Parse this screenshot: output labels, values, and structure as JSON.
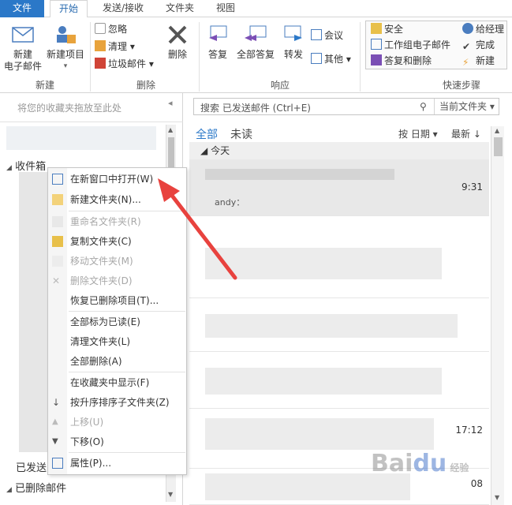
{
  "tabs": [
    "文件",
    "开始",
    "发送/接收",
    "文件夹",
    "视图"
  ],
  "ribbon": {
    "new_group": {
      "label": "新建",
      "new_mail": "新建\n电子邮件",
      "new_items": "新建项目"
    },
    "delete_group": {
      "label": "删除",
      "ignore": "忽略",
      "clean": "清理",
      "junk": "垃圾邮件",
      "delete": "删除"
    },
    "respond_group": {
      "label": "响应",
      "reply": "答复",
      "reply_all": "全部答复",
      "forward": "转发",
      "meeting": "会议",
      "more": "其他"
    },
    "quick_steps": {
      "label": "快速步骤",
      "items": [
        "安全",
        "给经理",
        "工作组电子邮件",
        "完成",
        "答复和删除",
        "新建"
      ]
    }
  },
  "left": {
    "fav_hint": "将您的收藏夹拖放至此处",
    "inbox": "收件箱",
    "sent": "已发送",
    "deleted": "已删除邮件"
  },
  "context_menu": [
    {
      "label": "在新窗口中打开(W)",
      "disabled": false
    },
    {
      "label": "新建文件夹(N)...",
      "disabled": false
    },
    {
      "label": "重命名文件夹(R)",
      "disabled": true
    },
    {
      "label": "复制文件夹(C)",
      "disabled": false
    },
    {
      "label": "移动文件夹(M)",
      "disabled": true
    },
    {
      "label": "删除文件夹(D)",
      "disabled": true
    },
    {
      "label": "恢复已删除项目(T)...",
      "disabled": false
    },
    {
      "label": "全部标为已读(E)",
      "disabled": false
    },
    {
      "label": "清理文件夹(L)",
      "disabled": false
    },
    {
      "label": "全部删除(A)",
      "disabled": false
    },
    {
      "label": "在收藏夹中显示(F)",
      "disabled": false
    },
    {
      "label": "按升序排序子文件夹(Z)",
      "disabled": false
    },
    {
      "label": "上移(U)",
      "disabled": true
    },
    {
      "label": "下移(O)",
      "disabled": false
    },
    {
      "label": "属性(P)...",
      "disabled": false
    }
  ],
  "middle": {
    "search_placeholder": "搜索 已发送邮件 (Ctrl+E)",
    "scope": "当前文件夹",
    "filter_all": "全部",
    "filter_unread": "未读",
    "sort_by": "按 日期",
    "sort_order": "最新 ↓",
    "today": "今天",
    "mail_sender_snippet": "andy：",
    "times": [
      "9:31",
      "17:12",
      "08"
    ]
  },
  "colors": {
    "accent": "#2b78c8",
    "arrow": "#e8423e"
  }
}
